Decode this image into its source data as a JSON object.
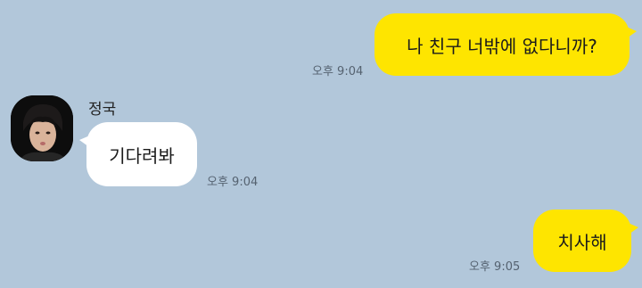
{
  "messages": [
    {
      "from": "me",
      "text": "나 친구 너밖에 없다니까?",
      "time": "오후 9:04"
    },
    {
      "from": "other",
      "sender": "정국",
      "avatar": "profile-photo",
      "text": "기다려봐",
      "time": "오후 9:04"
    },
    {
      "from": "me",
      "text": "치사해",
      "time": "오후 9:05"
    }
  ],
  "colors": {
    "background": "#b2c7da",
    "my_bubble": "#fee500",
    "other_bubble": "#ffffff",
    "timestamp": "#556270"
  }
}
